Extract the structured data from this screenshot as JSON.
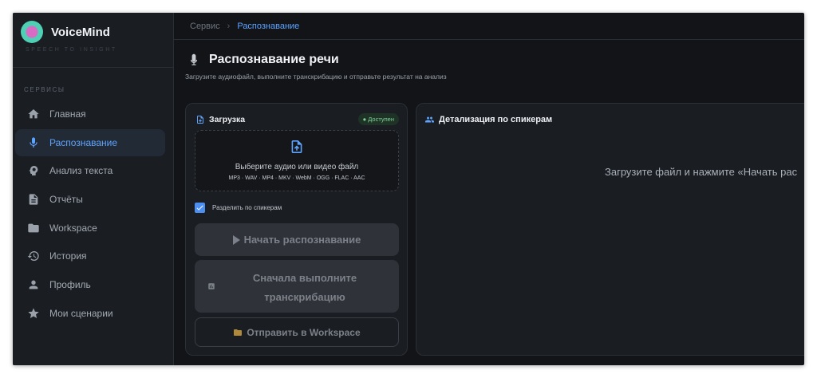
{
  "app": {
    "name": "VoiceMind",
    "tagline": "SPEECH TO INSIGHT"
  },
  "sidebar": {
    "section_label": "СЕРВИСЫ",
    "items": [
      {
        "label": "Главная",
        "icon": "home-icon",
        "active": false
      },
      {
        "label": "Распознавание",
        "icon": "mic-icon",
        "active": true
      },
      {
        "label": "Анализ текста",
        "icon": "psychology-icon",
        "active": false
      },
      {
        "label": "Отчёты",
        "icon": "document-icon",
        "active": false
      },
      {
        "label": "Workspace",
        "icon": "folder-icon",
        "active": false
      },
      {
        "label": "История",
        "icon": "history-icon",
        "active": false
      },
      {
        "label": "Профиль",
        "icon": "person-icon",
        "active": false
      },
      {
        "label": "Мои сценарии",
        "icon": "star-icon",
        "active": false
      }
    ]
  },
  "breadcrumb": {
    "root": "Сервис",
    "separator": "›",
    "current": "Распознавание"
  },
  "page": {
    "title": "Распознавание речи",
    "subtitle": "Загрузите аудиофайл, выполните транскрибацию и отправьте результат на анализ"
  },
  "upload": {
    "title": "Загрузка",
    "status_badge": "● Доступен",
    "dropzone_title": "Выберите аудио или видео файл",
    "dropzone_formats": "MP3 · WAV · MP4 · MKV · WebM · OGG · FLAC · AAC",
    "split_speakers_label": "Разделить по спикерам",
    "split_speakers_checked": true,
    "start_button": "Начать распознавание",
    "analyze_button_line1": "Сначала выполните",
    "analyze_button_line2": "транскрибацию",
    "workspace_button": "Отправить в Workspace"
  },
  "speakers": {
    "title": "Детализация по спикерам",
    "empty_text": "Загрузите файл и нажмите «Начать рас"
  },
  "colors": {
    "accent": "#5ea4ff",
    "background": "#121417",
    "panel": "#1a1d22",
    "success": "#7fd39b"
  }
}
